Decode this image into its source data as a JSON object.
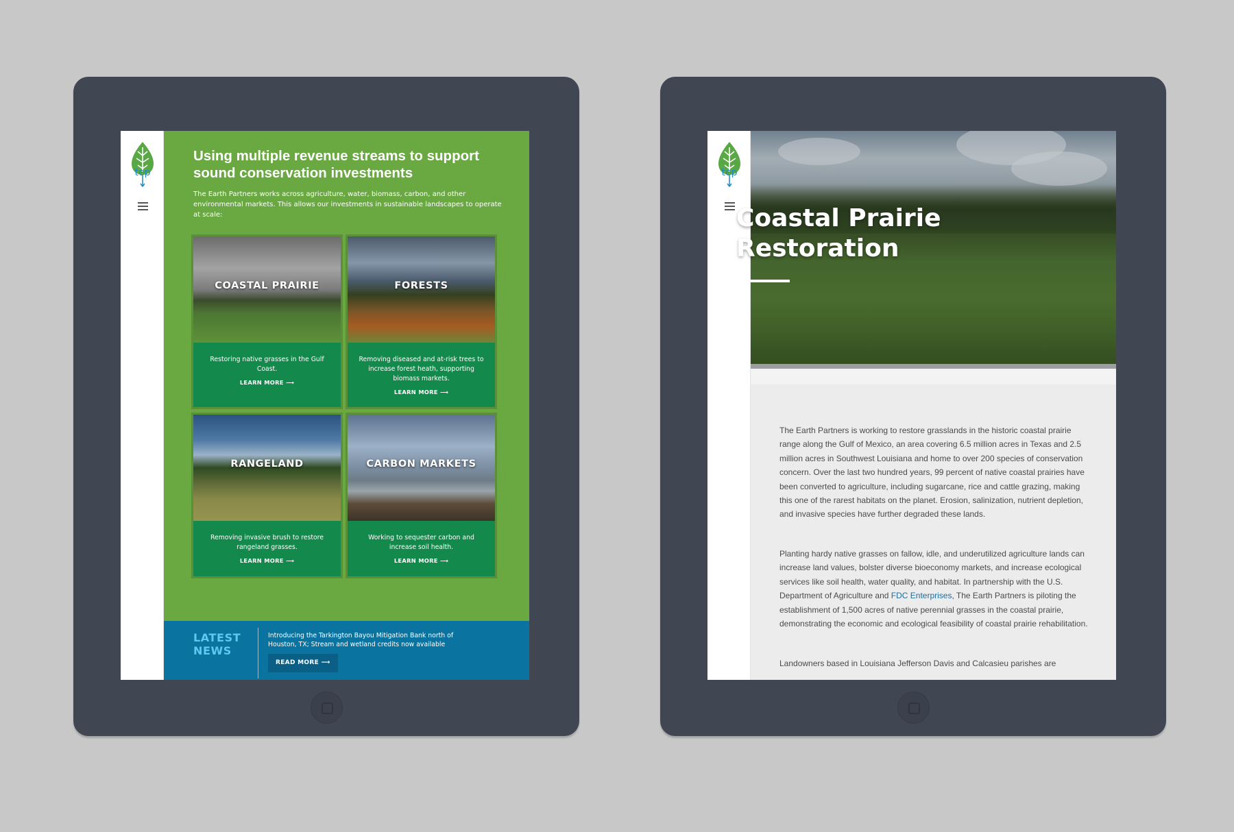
{
  "left_page": {
    "hero": {
      "title": "Using multiple revenue streams to support sound conservation investments",
      "text": "The Earth Partners works across agriculture, water, biomass, carbon, and other environmental markets. This allows our investments in sustainable landscapes to operate at scale:"
    },
    "cards": [
      {
        "label": "COASTAL PRAIRIE",
        "desc": "Restoring native grasses in the Gulf Coast.",
        "more": "LEARN MORE ⟶"
      },
      {
        "label": "FORESTS",
        "desc": "Removing diseased and at-risk trees to increase forest heath, supporting biomass markets.",
        "more": "LEARN MORE ⟶"
      },
      {
        "label": "RANGELAND",
        "desc": "Removing invasive brush to restore rangeland grasses.",
        "more": "LEARN MORE ⟶"
      },
      {
        "label": "CARBON MARKETS",
        "desc": "Working to sequester carbon and increase soil health.",
        "more": "LEARN MORE ⟶"
      }
    ],
    "news": {
      "title": "LATEST NEWS",
      "text": "Introducing the Tarkington Bayou Mitigation Bank north of Houston, TX; Stream and wetland credits now available",
      "button": "READ MORE ⟶"
    }
  },
  "right_page": {
    "heading": "Coastal Prairie Restoration",
    "p1": "The Earth Partners is working to restore grasslands in the historic coastal prairie range along the Gulf of Mexico, an area covering 6.5 million acres in Texas and 2.5 million acres in Southwest Louisiana and home to over 200 species of conservation concern. Over the last two hundred years, 99 percent of native coastal prairies have been converted to agriculture, including sugarcane, rice and cattle grazing, making this one of the rarest habitats on the planet. Erosion, salinization, nutrient depletion, and invasive species have further degraded these lands.",
    "p2_before": "Planting hardy native grasses on fallow, idle, and underutilized agriculture lands can increase land values, bolster diverse bioeconomy markets, and increase ecological services like soil health, water quality, and habitat. In partnership with the U.S. Department of Agriculture and ",
    "p2_link": "FDC Enterprises",
    "p2_after": ", The Earth Partners is piloting the establishment of 1,500 acres of native perennial grasses in the coastal prairie, demonstrating the economic and ecological feasibility of coastal prairie rehabilitation.",
    "p3": "Landowners based in Louisiana Jefferson Davis and Calcasieu parishes are"
  },
  "logo": {
    "text": "tep",
    "icon": "leaf-logo-icon"
  },
  "colors": {
    "green": "#6aa842",
    "card_green": "#138a4b",
    "news_blue": "#0b73a0",
    "tablet": "#404652"
  }
}
